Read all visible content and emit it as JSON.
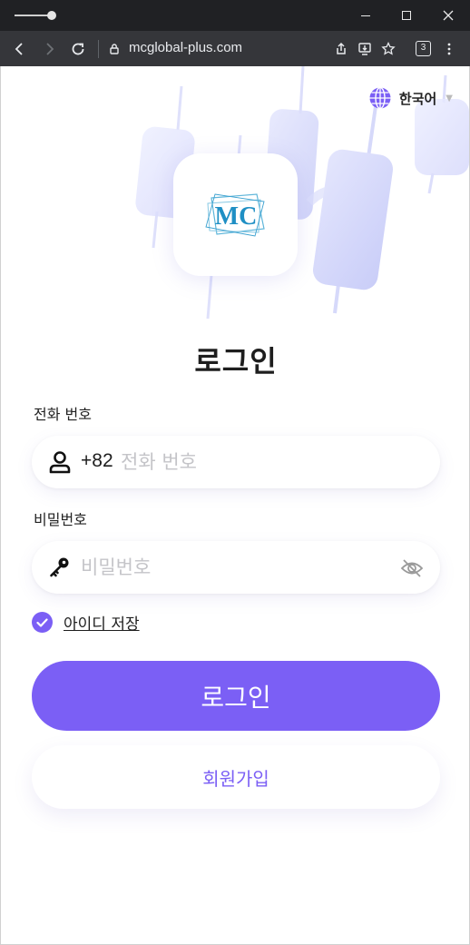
{
  "browser": {
    "url": "mcglobal-plus.com",
    "tab_count": "3"
  },
  "page": {
    "language": "한국어",
    "logo_text": "MC",
    "title": "로그인",
    "phone": {
      "label": "전화 번호",
      "prefix": "+82",
      "placeholder": "전화 번호",
      "value": ""
    },
    "password": {
      "label": "비밀번호",
      "placeholder": "비밀번호",
      "value": ""
    },
    "remember": {
      "label": "아이디 저장",
      "checked": true
    },
    "login_button": "로그인",
    "signup_button": "회원가입"
  },
  "colors": {
    "accent": "#7b5ff5",
    "titlebar": "#202124",
    "addressbar": "#35363a"
  }
}
